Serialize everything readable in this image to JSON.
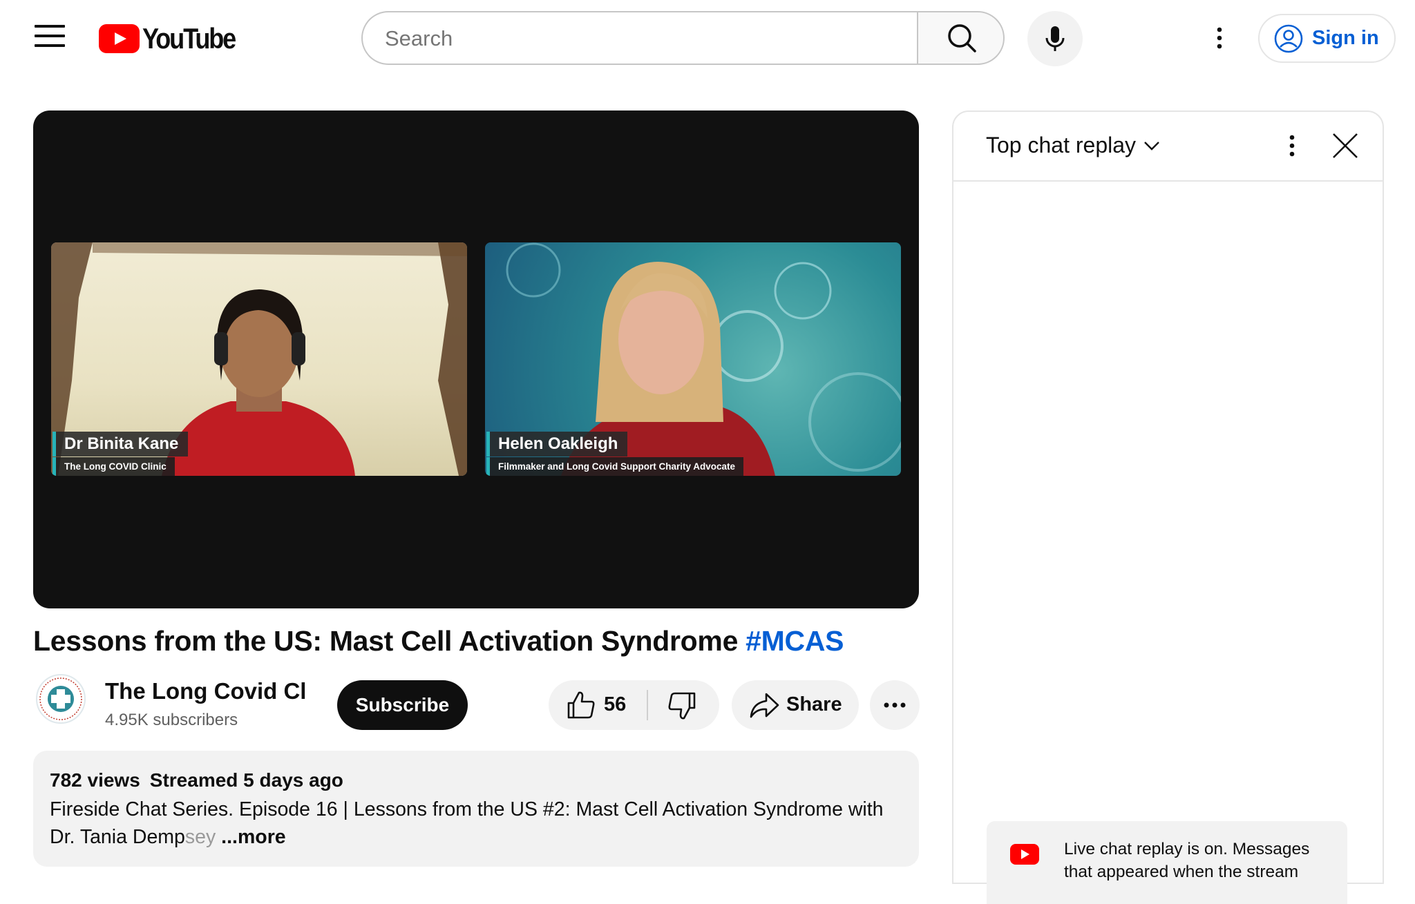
{
  "header": {
    "logo_text": "YouTube",
    "search_placeholder": "Search",
    "sign_in_label": "Sign in",
    "accent_red": "#ff0000",
    "link_blue": "#065fd4"
  },
  "video": {
    "participants": [
      {
        "name": "Dr Binita Kane",
        "role": "The Long COVID Clinic"
      },
      {
        "name": "Helen Oakleigh",
        "role": "Filmmaker and Long Covid Support Charity Advocate"
      }
    ],
    "title": "Lessons from the US: Mast Cell Activation Syndrome",
    "hashtag": "#MCAS"
  },
  "channel": {
    "name": "The Long Covid Cl...",
    "subscribers": "4.95K subscribers",
    "subscribe_label": "Subscribe"
  },
  "actions": {
    "like_count": "56",
    "share_label": "Share"
  },
  "description": {
    "views": "782 views",
    "streamed": "Streamed 5 days ago",
    "text_main": "Fireside Chat Series. Episode 16 | Lessons from the US #2: Mast Cell Activation Syndrome with Dr. Tania Demp",
    "text_fade": "sey",
    "more_label": " ...more"
  },
  "chat": {
    "mode_label": "Top chat replay",
    "notice": "Live chat replay is on. Messages that appeared when the stream"
  }
}
